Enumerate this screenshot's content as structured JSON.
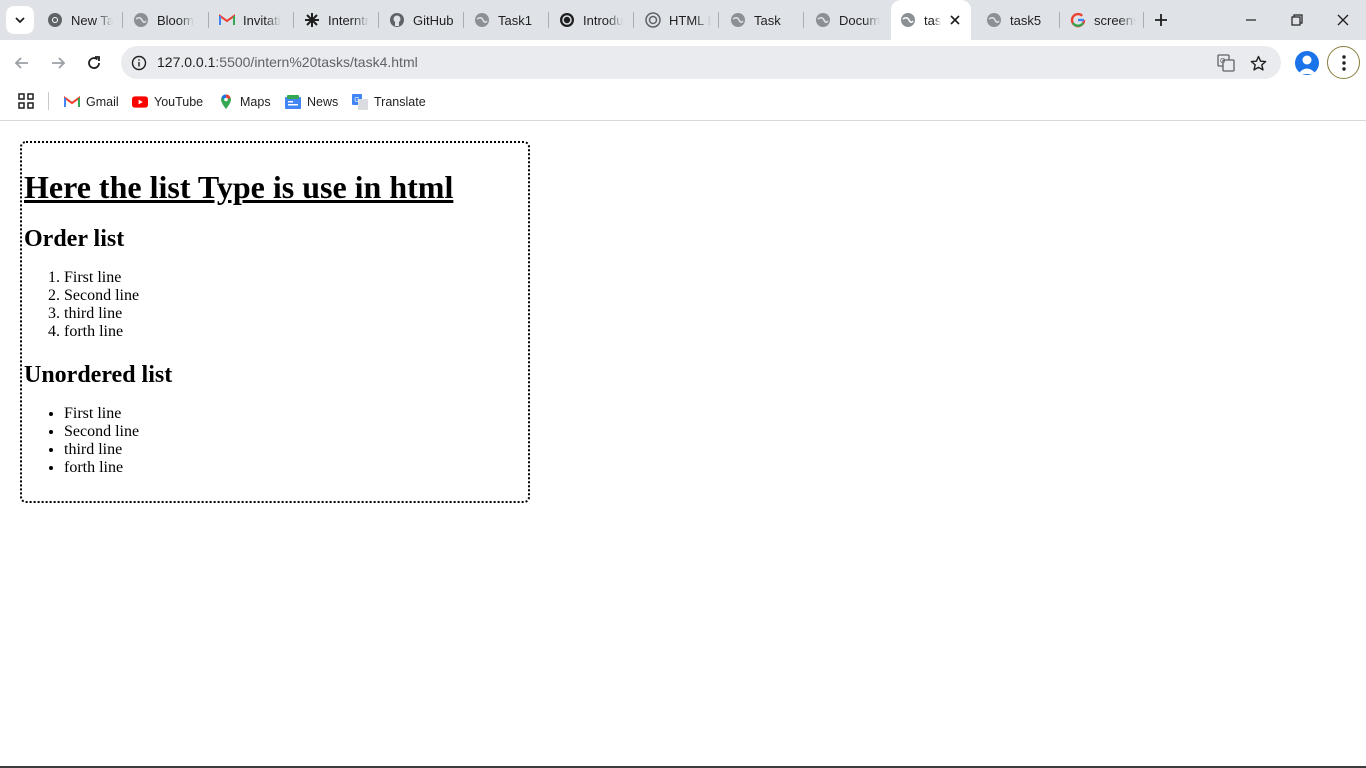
{
  "browser": {
    "tabs": [
      {
        "title": "New Ta",
        "icon": "chrome-icon"
      },
      {
        "title": "Bloom",
        "icon": "globe-icon"
      },
      {
        "title": "Invitati",
        "icon": "gmail-icon"
      },
      {
        "title": "Interntr",
        "icon": "asterisk-icon"
      },
      {
        "title": "GitHub",
        "icon": "github-icon"
      },
      {
        "title": "Task1",
        "icon": "globe-icon"
      },
      {
        "title": "Introdu",
        "icon": "openai-icon"
      },
      {
        "title": "HTML E",
        "icon": "openai-icon"
      },
      {
        "title": "Task",
        "icon": "globe-icon"
      },
      {
        "title": "Docum",
        "icon": "globe-icon"
      },
      {
        "title": "tas",
        "icon": "globe-icon",
        "active": true
      },
      {
        "title": "task5",
        "icon": "globe-icon"
      },
      {
        "title": "screens",
        "icon": "google-icon"
      }
    ],
    "url_host": "127.0.0.1",
    "url_rest": ":5500/intern%20tasks/task4.html",
    "bookmarks": [
      {
        "label": "Gmail",
        "icon": "gmail-icon"
      },
      {
        "label": "YouTube",
        "icon": "youtube-icon"
      },
      {
        "label": "Maps",
        "icon": "maps-icon"
      },
      {
        "label": "News",
        "icon": "news-icon"
      },
      {
        "label": "Translate",
        "icon": "translate-icon"
      }
    ]
  },
  "page": {
    "heading": "Here the list Type is use in html",
    "ordered_title": "Order list",
    "ordered_items": [
      "First line",
      "Second line",
      "third line",
      "forth line"
    ],
    "unordered_title": "Unordered list",
    "unordered_items": [
      "First line",
      "Second line",
      "third line",
      "forth line"
    ]
  },
  "colors": {
    "tabstrip": "#dfe3e8",
    "omnibox": "#e9ebee",
    "accent": "#1a73e8"
  }
}
